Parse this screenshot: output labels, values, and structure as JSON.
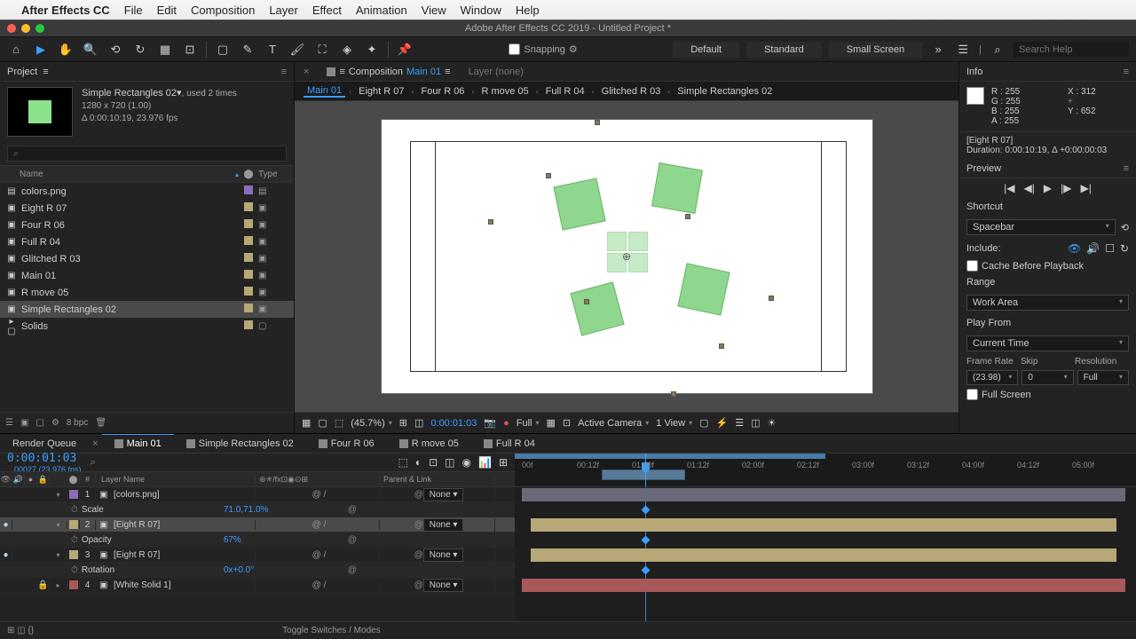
{
  "menubar": {
    "app": "After Effects CC",
    "items": [
      "File",
      "Edit",
      "Composition",
      "Layer",
      "Effect",
      "Animation",
      "View",
      "Window",
      "Help"
    ]
  },
  "window_title": "Adobe After Effects CC 2019 - Untitled Project *",
  "toolbar": {
    "snapping": "Snapping",
    "workspaces": [
      "Default",
      "Standard",
      "Small Screen"
    ],
    "search_placeholder": "Search Help"
  },
  "project": {
    "panel_title": "Project",
    "sel_name": "Simple Rectangles 02▾",
    "sel_used": ", used 2 times",
    "sel_dims": "1280 x 720 (1.00)",
    "sel_dur": "Δ 0:00:10:19, 23.976 fps",
    "search_placeholder": "⌕",
    "cols": {
      "name": "Name",
      "label": "⬤",
      "type": "Type"
    },
    "items": [
      {
        "icon": "▤",
        "name": "colors.png",
        "color": "#8a6cb8",
        "type": "▤"
      },
      {
        "icon": "▣",
        "name": "Eight R 07",
        "color": "#b8a878",
        "type": "▣"
      },
      {
        "icon": "▣",
        "name": "Four R 06",
        "color": "#b8a878",
        "type": "▣"
      },
      {
        "icon": "▣",
        "name": "Full R 04",
        "color": "#b8a878",
        "type": "▣"
      },
      {
        "icon": "▣",
        "name": "Glitched R 03",
        "color": "#b8a878",
        "type": "▣"
      },
      {
        "icon": "▣",
        "name": "Main 01",
        "color": "#b8a878",
        "type": "▣"
      },
      {
        "icon": "▣",
        "name": "R move 05",
        "color": "#b8a878",
        "type": "▣"
      },
      {
        "icon": "▣",
        "name": "Simple Rectangles 02",
        "color": "#b8a878",
        "type": "▣",
        "sel": true
      },
      {
        "icon": "▸ ▢",
        "name": "Solids",
        "color": "#b8a878",
        "type": "▢"
      }
    ],
    "footer_bpc": "8 bpc"
  },
  "comp": {
    "tab_prefix": "Composition",
    "tab_name": "Main 01",
    "layer_tab": "Layer (none)",
    "flow": [
      "Main 01",
      "Eight R 07",
      "Four R 06",
      "R move 05",
      "Full R 04",
      "Glitched R 03",
      "Simple Rectangles 02"
    ],
    "footer": {
      "zoom": "(45.7%)",
      "time": "0:00:01:03",
      "res": "Full",
      "camera": "Active Camera",
      "view": "1 View"
    }
  },
  "info": {
    "title": "Info",
    "r": "R : 255",
    "g": "G : 255",
    "b": "B : 255",
    "a": "A : 255",
    "x": "X : 312",
    "y": "Y : 652",
    "layer": "[Eight R 07]",
    "duration": "Duration: 0:00:10:19, Δ +0:00:00:03"
  },
  "preview": {
    "title": "Preview",
    "shortcut_lbl": "Shortcut",
    "shortcut": "Spacebar",
    "include": "Include:",
    "cache": "Cache Before Playback",
    "range_lbl": "Range",
    "range": "Work Area",
    "playfrom_lbl": "Play From",
    "playfrom": "Current Time",
    "fr_lbl": "Frame Rate",
    "skip_lbl": "Skip",
    "res_lbl": "Resolution",
    "fr": "(23.98)",
    "skip": "0",
    "res": "Full",
    "fullscreen": "Full Screen"
  },
  "timeline": {
    "render_queue": "Render Queue",
    "tabs": [
      "Main 01",
      "Simple Rectangles 02",
      "Four R 06",
      "R move 05",
      "Full R 04"
    ],
    "timecode": "0:00:01:03",
    "frames": "00027 (23.976 fps)",
    "cols": {
      "num": "#",
      "layer": "Layer Name",
      "mode": "",
      "parent": "Parent & Link"
    },
    "ticks": [
      "00f",
      "00:12f",
      "01:00f",
      "01:12f",
      "02:00f",
      "02:12f",
      "03:00f",
      "03:12f",
      "04:00f",
      "04:12f",
      "05:00f"
    ],
    "layers": [
      {
        "eye": "",
        "lock": "",
        "twirl": "▾",
        "num": "1",
        "color": "#8a6cb8",
        "name": "[colors.png]",
        "mode": "@  /",
        "parent": "None",
        "bar_color": "#6a6a7a",
        "props": [
          {
            "name": "Scale",
            "val": "71.0,71.0%"
          }
        ]
      },
      {
        "eye": "●",
        "lock": "",
        "twirl": "▾",
        "num": "2",
        "color": "#b8a878",
        "name": "[Eight R 07]",
        "mode": "@  /",
        "parent": "None",
        "bar_color": "#b8a878",
        "sel": true,
        "props": [
          {
            "name": "Opacity",
            "val": "67%"
          }
        ]
      },
      {
        "eye": "●",
        "lock": "",
        "twirl": "▾",
        "num": "3",
        "color": "#b8a878",
        "name": "[Eight R 07]",
        "mode": "@  /",
        "parent": "None",
        "bar_color": "#b8a878",
        "props": [
          {
            "name": "Rotation",
            "val": "0x+0.0°"
          }
        ]
      },
      {
        "eye": "",
        "lock": "🔒",
        "twirl": "▸",
        "num": "4",
        "color": "#a85858",
        "name": "[White Solid 1]",
        "mode": "@  /",
        "parent": "None",
        "bar_color": "#a85858"
      }
    ],
    "footer": "Toggle Switches / Modes"
  }
}
